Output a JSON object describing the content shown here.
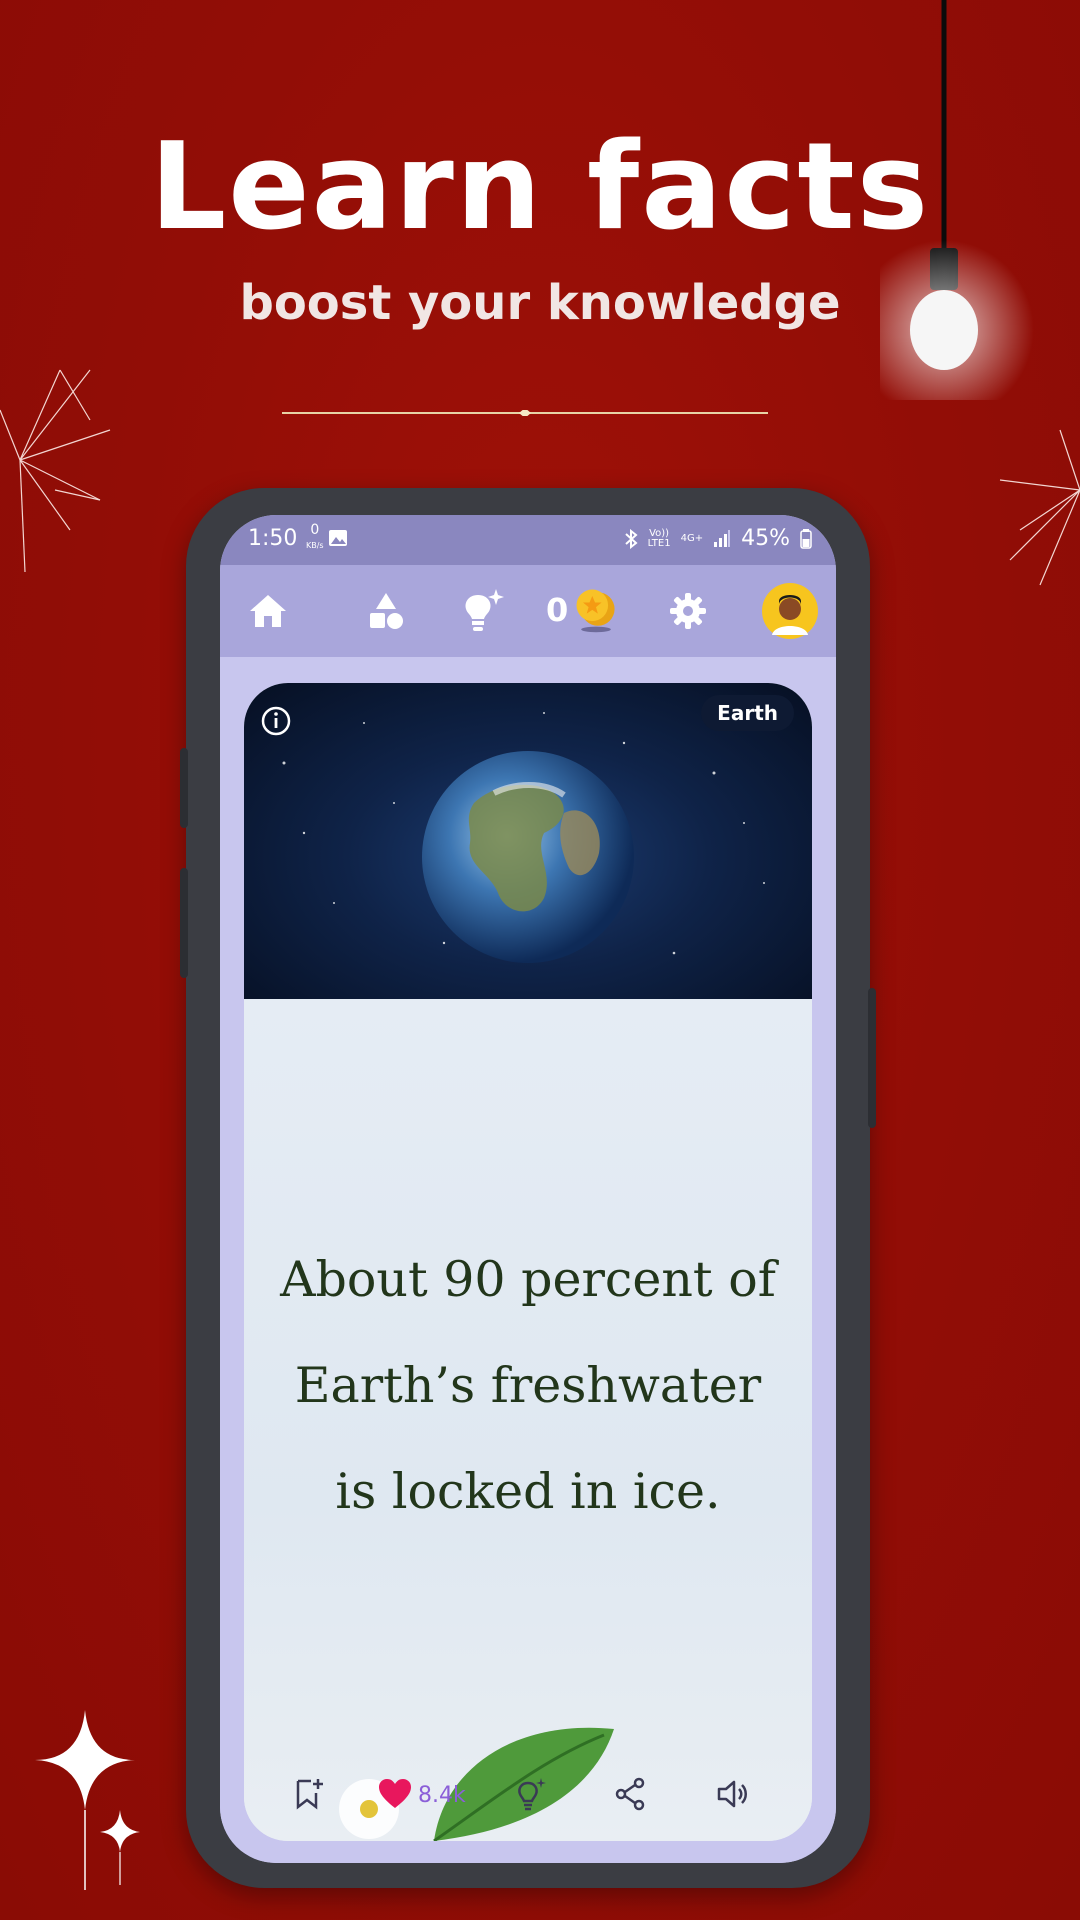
{
  "promo": {
    "title": "Learn facts",
    "subtitle": "boost your knowledge"
  },
  "status_bar": {
    "time": "1:50",
    "net_speed": "0",
    "net_unit": "KB/s",
    "network": "4G+",
    "lte": "LTE1",
    "volte": "Vo))",
    "battery": "45%"
  },
  "app_bar": {
    "coins": "0",
    "icons": [
      "home-icon",
      "categories-icon",
      "idea-icon",
      "coin-icon",
      "gear-icon",
      "avatar"
    ]
  },
  "card": {
    "category_tag": "Earth",
    "fact_line1": "About 90 percent of",
    "fact_line2": "Earth’s freshwater",
    "fact_line3": "is locked in ice.",
    "likes": "8.4k"
  },
  "colors": {
    "background": "#920d06",
    "appbar": "#a9a6db",
    "statusbar": "#8a87bf",
    "fact_text": "#22361b",
    "like": "#e8175d",
    "likes_text": "#8b5fd8"
  }
}
